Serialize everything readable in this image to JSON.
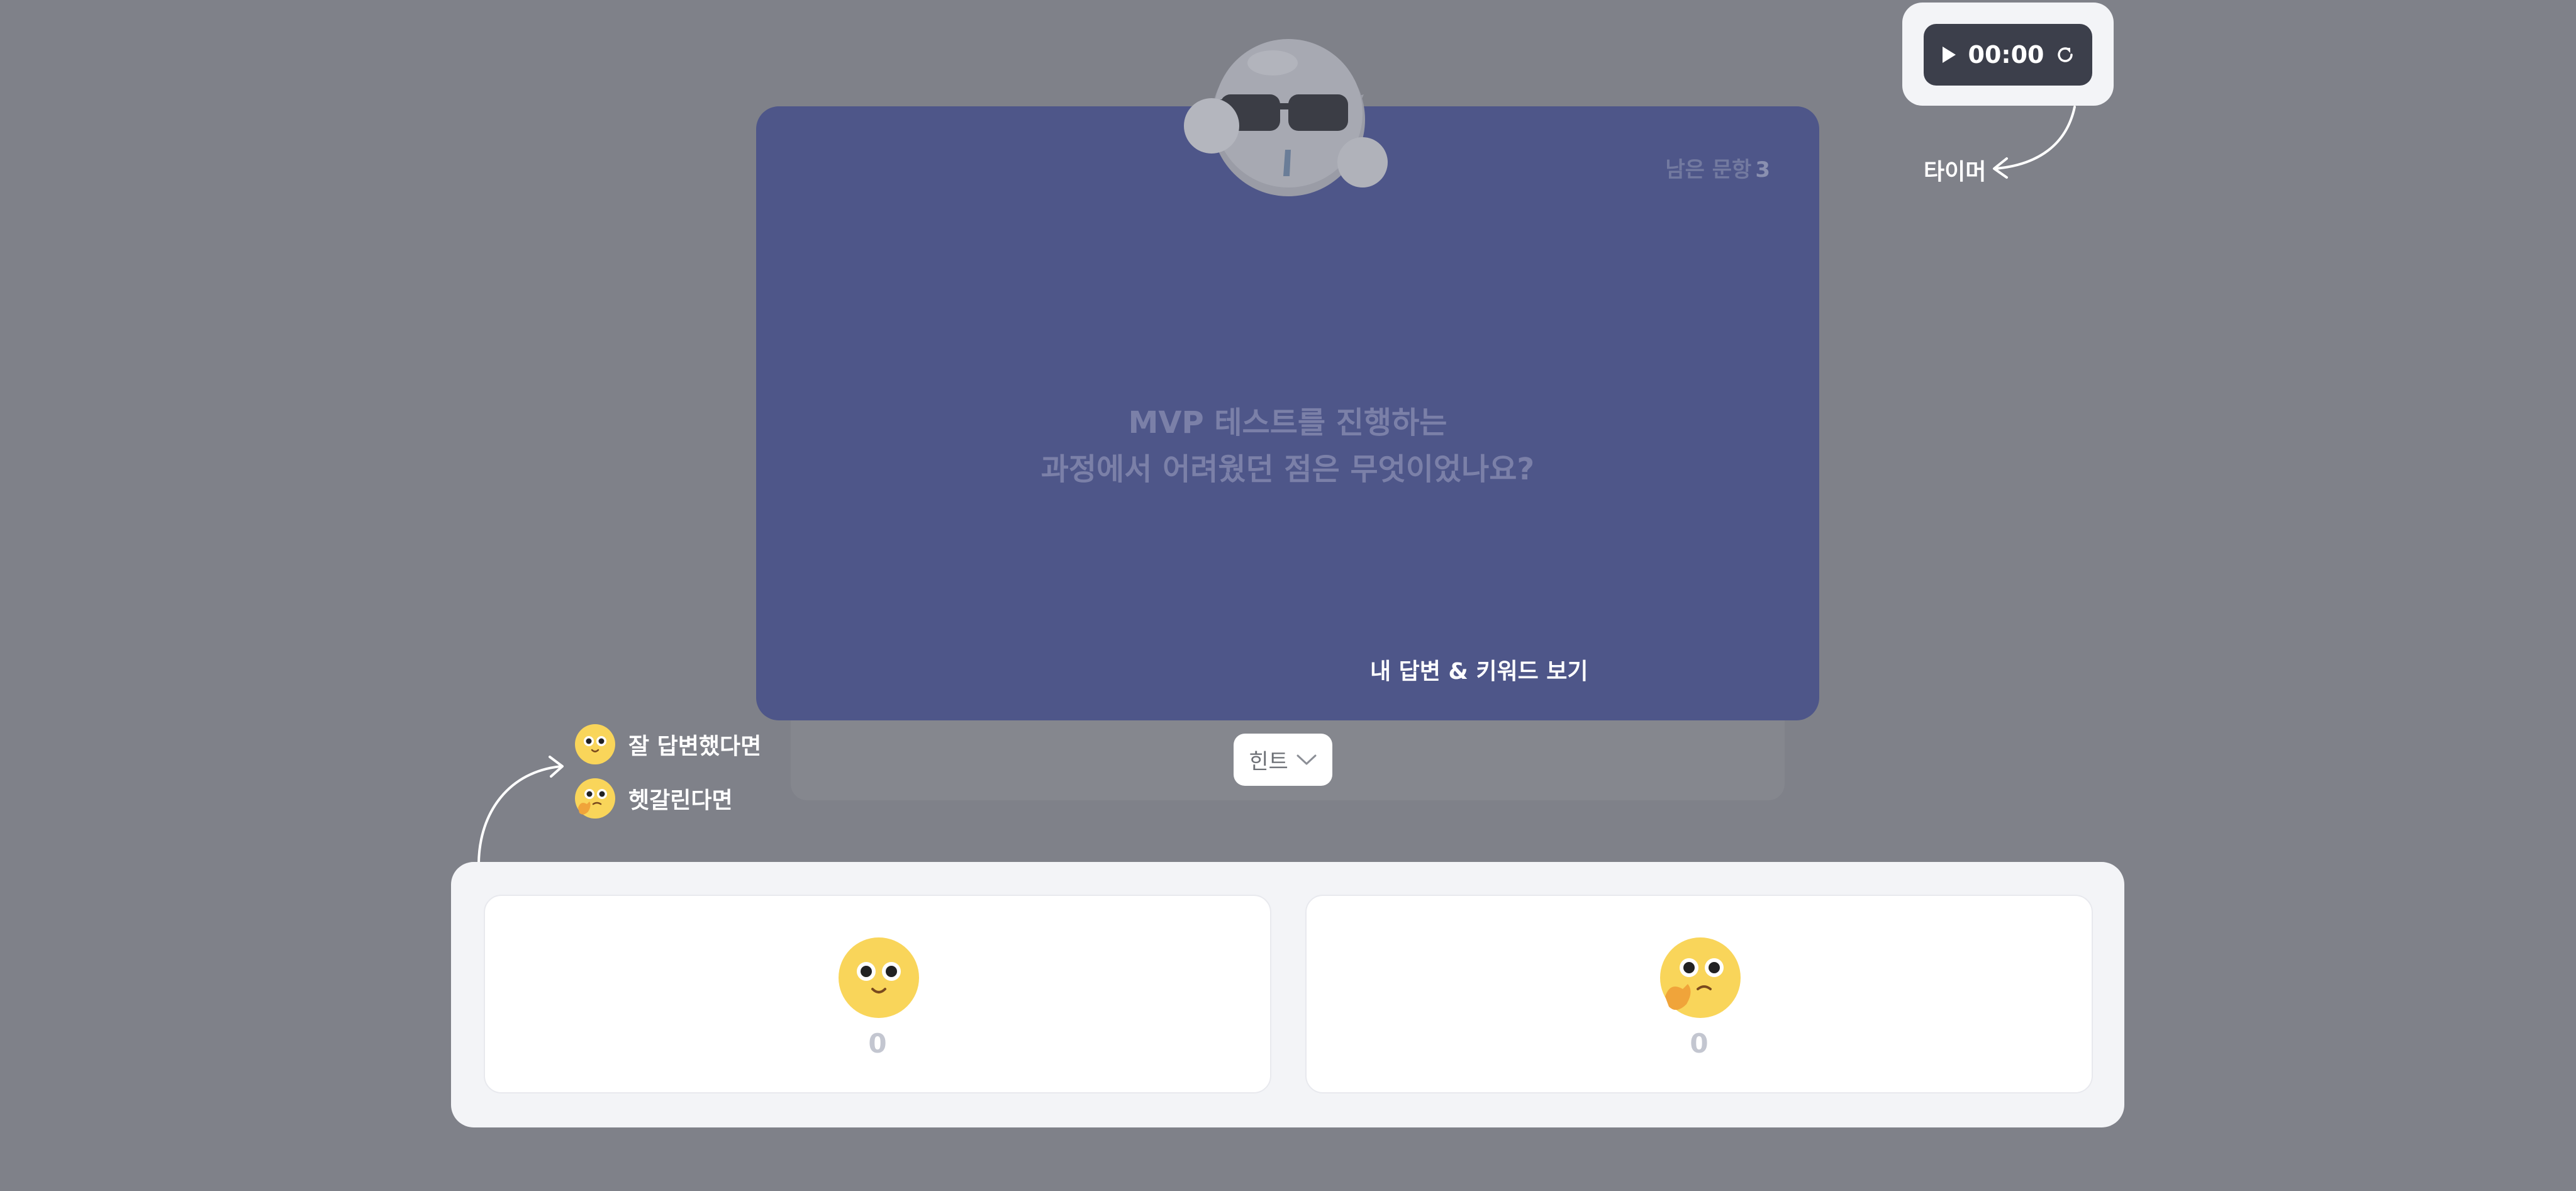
{
  "question_card": {
    "remaining_label": "남은 문항",
    "remaining_count": "3",
    "question_line1": "MVP 테스트를 진행하는",
    "question_line2": "과정에서 어려웠던 점은 무엇이었나요?"
  },
  "hint": {
    "label": "힌트",
    "icon": "chevron-down-icon"
  },
  "timer": {
    "time": "00:00",
    "play_icon": "play-icon",
    "reset_icon": "refresh-icon",
    "callout": "타이머"
  },
  "answer_callout": "내 답변 & 키워드 보기",
  "legend": {
    "good_label": "잘 답변했다면",
    "confused_label": "헷갈린다면"
  },
  "votes": {
    "good_count": "0",
    "confused_count": "0"
  },
  "colors": {
    "background": "#7f8189",
    "card": "#4e5689",
    "panel": "#f3f4f7",
    "timer": "#3c3f4b",
    "emoji_yellow": "#f9d55a"
  }
}
